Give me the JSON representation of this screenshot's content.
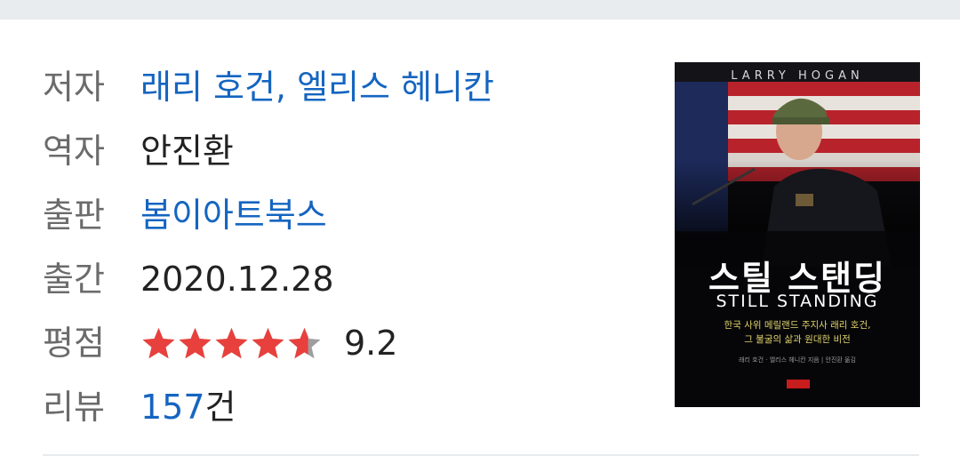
{
  "book": {
    "rows": {
      "author": {
        "label": "저자",
        "value": "래리 호건, 엘리스 헤니칸"
      },
      "translator": {
        "label": "역자",
        "value": "안진환"
      },
      "publisher": {
        "label": "출판",
        "value": "봄이아트북스"
      },
      "published": {
        "label": "출간",
        "value": "2020.12.28"
      },
      "rating": {
        "label": "평점",
        "score": "9.2",
        "stars": 4.6,
        "star_color": "#e8403d",
        "star_empty_color": "#9e9e9e"
      },
      "reviews": {
        "label": "리뷰",
        "count": "157",
        "suffix": "건"
      }
    },
    "cover": {
      "author_en": "LARRY HOGAN",
      "title_ko": "스틸 스탠딩",
      "title_en": "STILL STANDING",
      "subtitle_line1": "한국 사위 메릴랜드 주지사 래리 호건,",
      "subtitle_line2": "그 불굴의 삶과 원대한 비전",
      "credits": "래리 호건 · 엘리스 헤니칸 지음 | 안진환 옮김",
      "publisher_mark": "봄이아트북스"
    }
  },
  "colors": {
    "link": "#1565c0",
    "label": "#6b6b6b",
    "text": "#222222"
  }
}
